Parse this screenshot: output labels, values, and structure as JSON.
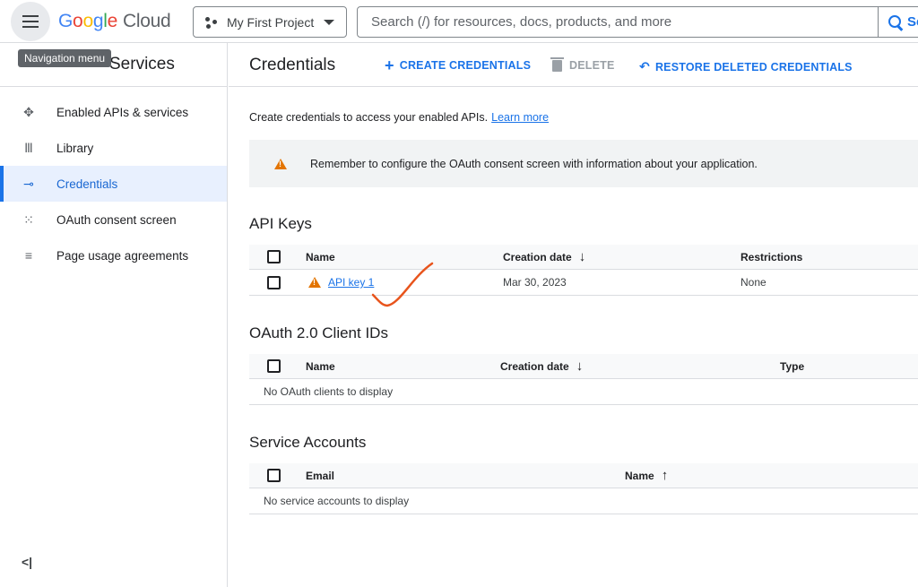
{
  "topbar": {
    "menu_tooltip": "Navigation menu",
    "logo": {
      "google": "Google",
      "cloud": "Cloud"
    },
    "project": "My First Project",
    "search_placeholder": "Search (/) for resources, docs, products, and more",
    "search_label": "Se"
  },
  "sidebar": {
    "title": "Services",
    "items": [
      {
        "label": "Enabled APIs & services",
        "icon": "api-icon"
      },
      {
        "label": "Library",
        "icon": "library-icon"
      },
      {
        "label": "Credentials",
        "icon": "key-icon",
        "active": true
      },
      {
        "label": "OAuth consent screen",
        "icon": "consent-icon"
      },
      {
        "label": "Page usage agreements",
        "icon": "settings-list-icon"
      }
    ],
    "collapse_label": "<|"
  },
  "main": {
    "title": "Credentials",
    "actions": {
      "create": "CREATE CREDENTIALS",
      "delete": "DELETE",
      "restore": "RESTORE DELETED CREDENTIALS"
    },
    "intro": "Create credentials to access your enabled APIs.",
    "learn_more": "Learn more",
    "banner": "Remember to configure the OAuth consent screen with information about your application.",
    "api_keys": {
      "title": "API Keys",
      "columns": [
        "Name",
        "Creation date",
        "Restrictions"
      ],
      "rows": [
        {
          "name": "API key 1",
          "date": "Mar 30, 2023",
          "restrictions": "None"
        }
      ]
    },
    "oauth": {
      "title": "OAuth 2.0 Client IDs",
      "columns": [
        "Name",
        "Creation date",
        "Type"
      ],
      "empty": "No OAuth clients to display"
    },
    "service_accounts": {
      "title": "Service Accounts",
      "columns": [
        "Email",
        "Name"
      ],
      "empty": "No service accounts to display"
    }
  },
  "colors": {
    "accent": "#1a73e8",
    "warning": "#e37400",
    "annotation": "#e8541c"
  }
}
